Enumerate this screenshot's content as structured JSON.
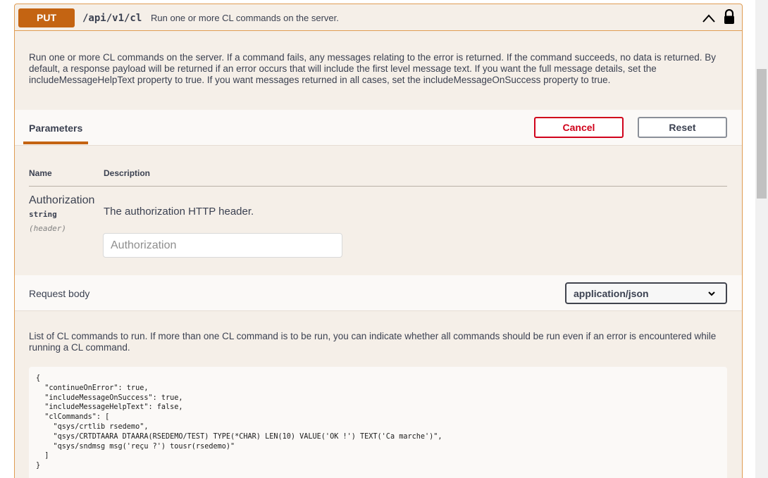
{
  "operation": {
    "method": "PUT",
    "path": "/api/v1/cl",
    "summary": "Run one or more CL commands on the server.",
    "description": "Run one or more CL commands on the server. If a command fails, any messages relating to the error is returned. If the command succeeds, no data is returned. By default, a response payload will be returned if an error occurs that will include the first level message text. If you want the full message details, set the includeMessageHelpText property to true. If you want messages returned in all cases, set the includeMessageOnSuccess property to true."
  },
  "parameters": {
    "tab_label": "Parameters",
    "cancel_label": "Cancel",
    "reset_label": "Reset",
    "col_name": "Name",
    "col_description": "Description",
    "items": [
      {
        "name": "Authorization",
        "type": "string",
        "in": "(header)",
        "description": "The authorization HTTP header.",
        "placeholder": "Authorization",
        "value": ""
      }
    ]
  },
  "request_body": {
    "label": "Request body",
    "content_type": "application/json",
    "description": "List of CL commands to run. If more than one CL command is to be run, you can indicate whether all commands should be run even if an error is encountered while running a CL command.",
    "example": "{\n  \"continueOnError\": true,\n  \"includeMessageOnSuccess\": true,\n  \"includeMessageHelpText\": false,\n  \"clCommands\": [\n    \"qsys/crtlib rsedemo\",\n    \"qsys/CRTDTAARA DTAARA(RSEDEMO/TEST) TYPE(*CHAR) LEN(10) VALUE('OK !') TEXT('Ca marche')\",\n    \"qsys/sndmsg msg('reçu ?') tousr(rsedemo)\"\n  ]\n}"
  },
  "icons": {
    "collapse": "chevron-up-icon",
    "lock": "lock-icon",
    "select": "chevron-down-icon"
  },
  "colors": {
    "method_badge": "#c46412",
    "border": "#e09c52",
    "cancel": "#d0021b"
  }
}
